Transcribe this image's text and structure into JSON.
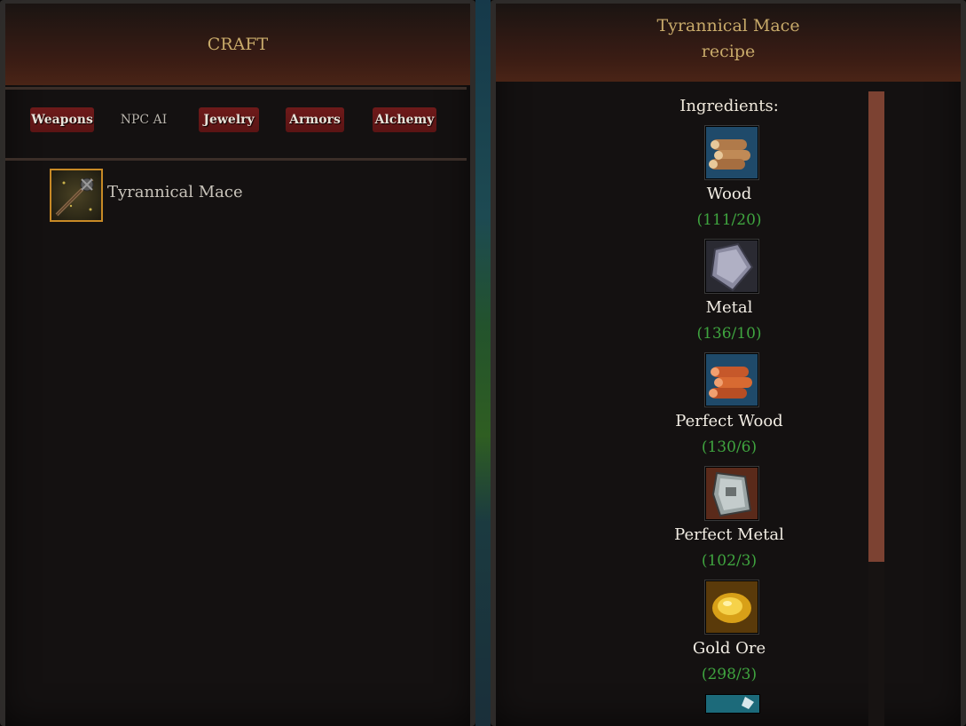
{
  "left_panel": {
    "title": "CRAFT",
    "tabs": [
      {
        "label": "Weapons",
        "highlighted": true
      },
      {
        "label": "NPC AI",
        "highlighted": false
      },
      {
        "label": "Jewelry",
        "highlighted": true
      },
      {
        "label": "Armors",
        "highlighted": true
      },
      {
        "label": "Alchemy",
        "highlighted": true
      }
    ],
    "recipes": [
      {
        "name": "Tyrannical Mace",
        "icon": "mace-icon",
        "selected": true
      }
    ]
  },
  "right_panel": {
    "title_line1": "Tyrannical Mace",
    "title_line2": "recipe",
    "ingredients_heading": "Ingredients:",
    "ingredients": [
      {
        "name": "Wood",
        "count": "(111/20)",
        "icon": "wood-icon"
      },
      {
        "name": "Metal",
        "count": "(136/10)",
        "icon": "metal-icon"
      },
      {
        "name": "Perfect Wood",
        "count": "(130/6)",
        "icon": "perfect-wood-icon"
      },
      {
        "name": "Perfect Metal",
        "count": "(102/3)",
        "icon": "perfect-metal-icon"
      },
      {
        "name": "Gold Ore",
        "count": "(298/3)",
        "icon": "gold-ore-icon"
      }
    ]
  },
  "colors": {
    "header_gold": "#c8aa6a",
    "tab_red": "#6e1a1a",
    "count_green": "#3fa43f",
    "selection_border": "#c88a26",
    "scrollbar_thumb": "#7c4232"
  }
}
